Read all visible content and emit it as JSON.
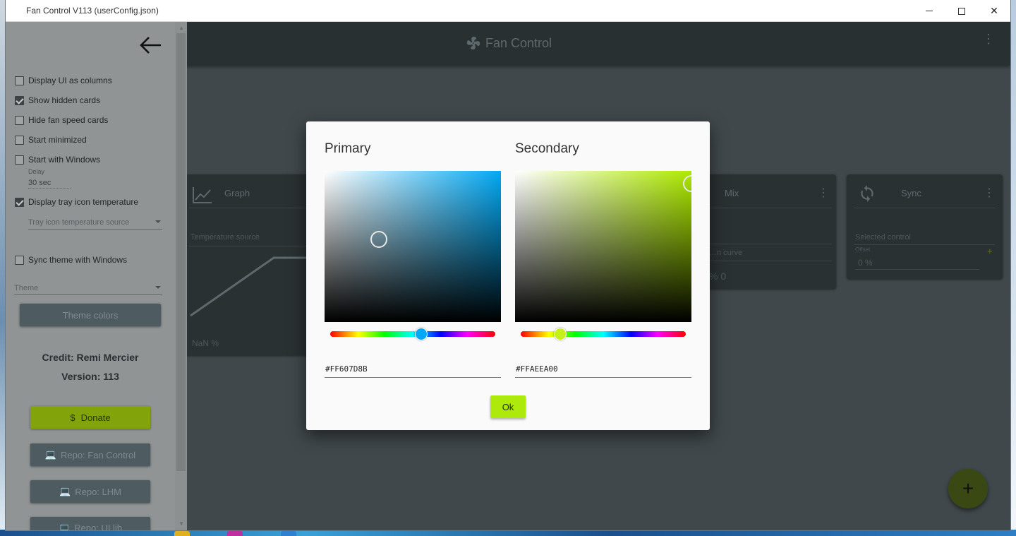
{
  "window": {
    "title": "Fan Control V113 (userConfig.json)",
    "minimize_icon": "minimize-icon",
    "maximize_icon": "maximize-icon",
    "close_icon": "close-icon"
  },
  "appbar": {
    "title": "Fan Control",
    "logo_icon": "fan-icon",
    "menu_icon": "kebab-menu-icon"
  },
  "cards": [
    {
      "title": "Graph",
      "icon": "graph-icon",
      "field": "Temperature source",
      "value": "NaN %"
    },
    {
      "title": "Mix",
      "icon": "mix-icon",
      "field": "…n curve",
      "value": "% 0"
    },
    {
      "title": "Sync",
      "icon": "sync-icon",
      "field": "Selected control",
      "offset_label": "Offset",
      "value": "0 %"
    }
  ],
  "drawer": {
    "back_icon": "arrow-left-icon",
    "options": [
      {
        "label": "Display UI as columns",
        "checked": false
      },
      {
        "label": "Show hidden cards",
        "checked": true
      },
      {
        "label": "Hide fan speed cards",
        "checked": false
      },
      {
        "label": "Start minimized",
        "checked": false
      },
      {
        "label": "Start with Windows",
        "checked": false
      },
      {
        "label": "Display tray icon temperature",
        "checked": true
      },
      {
        "label": "Sync theme with Windows",
        "checked": false
      }
    ],
    "delay_label": "Delay",
    "delay_value": "30 sec",
    "tray_source_placeholder": "Tray icon temperature source",
    "theme_placeholder": "Theme",
    "theme_colors_button": "Theme colors",
    "credit": "Credit: Remi Mercier",
    "version": "Version: 113",
    "donate": {
      "label": "Donate",
      "icon": "dollar-icon"
    },
    "repos": [
      {
        "label": "Repo: Fan Control",
        "icon": "laptop-icon"
      },
      {
        "label": "Repo: LHM",
        "icon": "laptop-icon"
      },
      {
        "label": "Repo: UI lib",
        "icon": "laptop-icon"
      }
    ]
  },
  "dialog": {
    "primary": {
      "title": "Primary",
      "hex": "#FF607D8B",
      "hue_fraction": 0.55,
      "color": "#607D8B",
      "hue_color": "#03a9f4",
      "knob_color": "#03a9f4"
    },
    "secondary": {
      "title": "Secondary",
      "hex": "#FFAEEA00",
      "hue_fraction": 0.24,
      "color": "#AEEA00",
      "hue_color": "#aeea00",
      "knob_color": "#c6f01a"
    },
    "ok_label": "Ok"
  },
  "fab_icon": "plus-icon",
  "colors": {
    "accent": "#AEEA00",
    "app_bg": "#424A4D",
    "appbar_bg": "#2A3134",
    "drawer_bg": "#909494"
  }
}
